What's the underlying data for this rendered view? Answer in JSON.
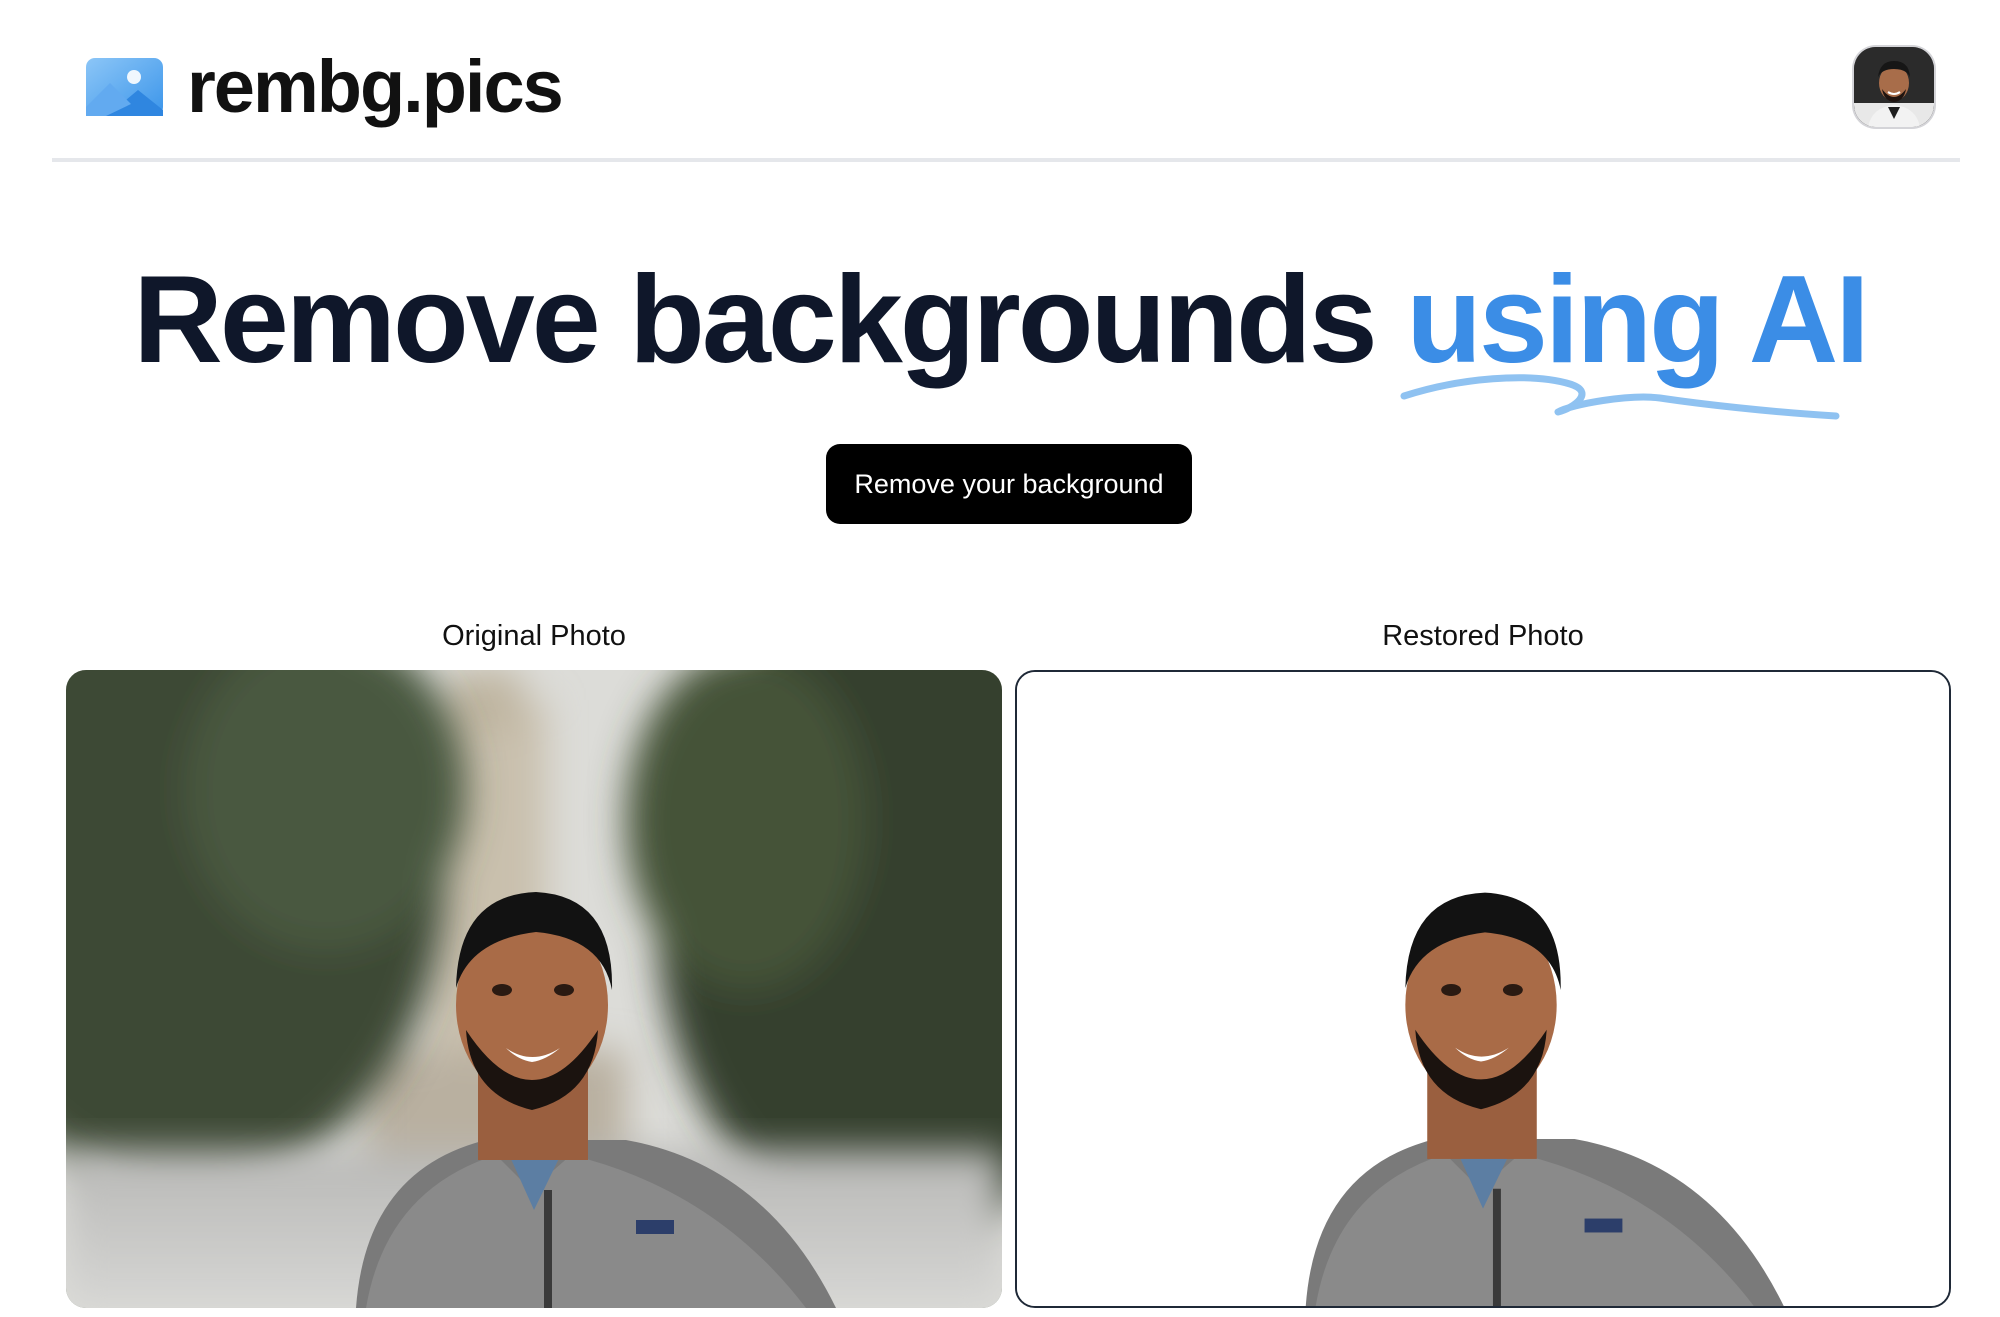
{
  "header": {
    "brand_name": "rembg.pics",
    "logo_icon": "image-photo-icon",
    "avatar_icon": "user-avatar-icon"
  },
  "hero": {
    "title_main": "Remove backgrounds",
    "title_accent": "using AI",
    "accent_color": "#3b8de6",
    "cta_label": "Remove your background"
  },
  "photos": {
    "original_label": "Original Photo",
    "restored_label": "Restored Photo"
  }
}
